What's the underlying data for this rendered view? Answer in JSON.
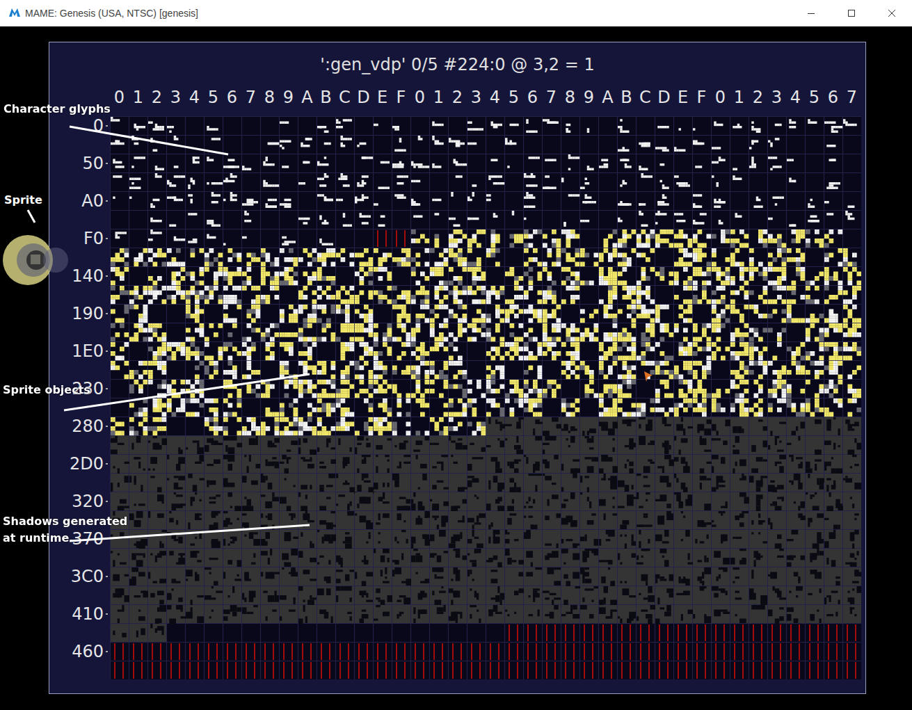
{
  "window": {
    "title": "MAME: Genesis (USA, NTSC) [genesis]"
  },
  "viewer": {
    "title": "':gen_vdp' 0/5 #224:0 @ 3,2 = 1",
    "columns": [
      "0",
      "1",
      "2",
      "3",
      "4",
      "5",
      "6",
      "7",
      "8",
      "9",
      "A",
      "B",
      "C",
      "D",
      "E",
      "F",
      "0",
      "1",
      "2",
      "3",
      "4",
      "5",
      "6",
      "7",
      "8",
      "9",
      "A",
      "B",
      "C",
      "D",
      "E",
      "F",
      "0",
      "1",
      "2",
      "3",
      "4",
      "5",
      "6",
      "7"
    ],
    "row_labels": [
      "0",
      "50",
      "A0",
      "F0",
      "140",
      "190",
      "1E0",
      "230",
      "280",
      "2D0",
      "320",
      "370",
      "3C0",
      "410",
      "460"
    ],
    "regions": [
      {
        "kind": "glyph",
        "count": 254
      },
      {
        "kind": "red",
        "count": 2
      },
      {
        "kind": "sprite",
        "count": 404
      },
      {
        "kind": "shadow",
        "count": 423
      },
      {
        "kind": "empty",
        "count": 18
      },
      {
        "kind": "red",
        "count": 99
      }
    ]
  },
  "annotations": [
    {
      "text": "Character glyphs"
    },
    {
      "text": "Sprite"
    },
    {
      "text": "Sprite objects"
    },
    {
      "text": "Shadows generated at runtime."
    }
  ]
}
